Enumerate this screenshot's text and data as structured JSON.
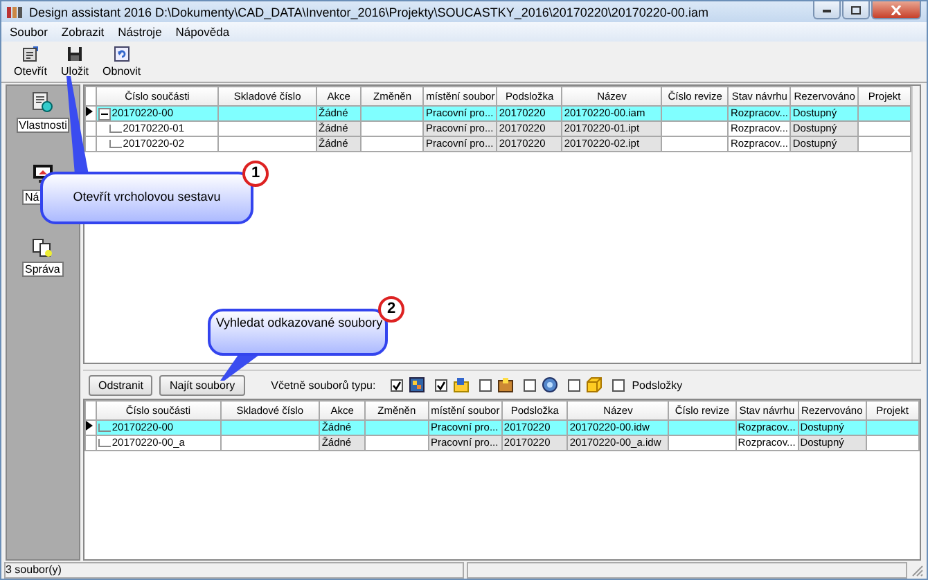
{
  "window": {
    "title": "Design assistant 2016 D:\\Dokumenty\\CAD_DATA\\Inventor_2016\\Projekty\\SOUCASTKY_2016\\20170220\\20170220-00.iam"
  },
  "menu": [
    "Soubor",
    "Zobrazit",
    "Nástroje",
    "Nápověda"
  ],
  "toolbar": [
    "Otevřít",
    "Uložit",
    "Obnovit"
  ],
  "sidebar": [
    {
      "label": "Vlastnosti"
    },
    {
      "label": "Ná"
    },
    {
      "label": "Správa"
    }
  ],
  "top_grid": {
    "columns": [
      {
        "label": "Číslo součásti",
        "readonly": false
      },
      {
        "label": "Skladové číslo",
        "readonly": false
      },
      {
        "label": "Akce",
        "readonly": true
      },
      {
        "label": "Změněn",
        "readonly": false
      },
      {
        "label": "místění soubor",
        "readonly": true
      },
      {
        "label": "Podsložka",
        "readonly": true
      },
      {
        "label": "Název",
        "readonly": true
      },
      {
        "label": "Číslo revize",
        "readonly": false
      },
      {
        "label": "Stav návrhu",
        "readonly": false
      },
      {
        "label": "Rezervováno",
        "readonly": true
      },
      {
        "label": "Projekt",
        "readonly": false
      }
    ],
    "rows": [
      {
        "cells": [
          "20170220-00",
          "",
          "Žádné",
          "",
          "Pracovní pro...",
          "20170220",
          "20170220-00.iam",
          "",
          "Rozpracov...",
          "Dostupný",
          ""
        ],
        "selected": true,
        "expanded": true,
        "children": [
          {
            "cells": [
              "20170220-01",
              "",
              "Žádné",
              "",
              "Pracovní pro...",
              "20170220",
              "20170220-01.ipt",
              "",
              "Rozpracov...",
              "Dostupný",
              ""
            ],
            "selected": false
          },
          {
            "cells": [
              "20170220-02",
              "",
              "Žádné",
              "",
              "Pracovní pro...",
              "20170220",
              "20170220-02.ipt",
              "",
              "Rozpracov...",
              "Dostupný",
              ""
            ],
            "selected": false
          }
        ]
      }
    ]
  },
  "bottom_toolbar": {
    "buttons": [
      "Odstranit",
      "Najít soubory"
    ],
    "filter_label": "Včetně souborů typu:",
    "file_types": [
      {
        "checked": true
      },
      {
        "checked": true
      },
      {
        "checked": false
      },
      {
        "checked": false
      },
      {
        "checked": false
      }
    ],
    "subfolders": {
      "label": "Podsložky",
      "checked": false
    }
  },
  "bottom_grid": {
    "columns": [
      {
        "label": "Číslo součásti",
        "readonly": false
      },
      {
        "label": "Skladové číslo",
        "readonly": false
      },
      {
        "label": "Akce",
        "readonly": true
      },
      {
        "label": "Změněn",
        "readonly": false
      },
      {
        "label": "místění soubor",
        "readonly": true
      },
      {
        "label": "Podsložka",
        "readonly": true
      },
      {
        "label": "Název",
        "readonly": true
      },
      {
        "label": "Číslo revize",
        "readonly": false
      },
      {
        "label": "Stav návrhu",
        "readonly": false
      },
      {
        "label": "Rezervováno",
        "readonly": true
      },
      {
        "label": "Projekt",
        "readonly": false
      }
    ],
    "rows": [
      {
        "cells": [
          "20170220-00",
          "",
          "Žádné",
          "",
          "Pracovní pro...",
          "20170220",
          "20170220-00.idw",
          "",
          "Rozpracov...",
          "Dostupný",
          ""
        ],
        "selected": true
      },
      {
        "cells": [
          "20170220-00_a",
          "",
          "Žádné",
          "",
          "Pracovní pro...",
          "20170220",
          "20170220-00_a.idw",
          "",
          "Rozpracov...",
          "Dostupný",
          ""
        ],
        "selected": false
      }
    ]
  },
  "callouts": [
    {
      "number": "1",
      "text": "Otevřít vrcholovou sestavu"
    },
    {
      "number": "2",
      "text": "Vyhledat odkazované soubory"
    }
  ],
  "status_bar": "3 soubor(y)"
}
